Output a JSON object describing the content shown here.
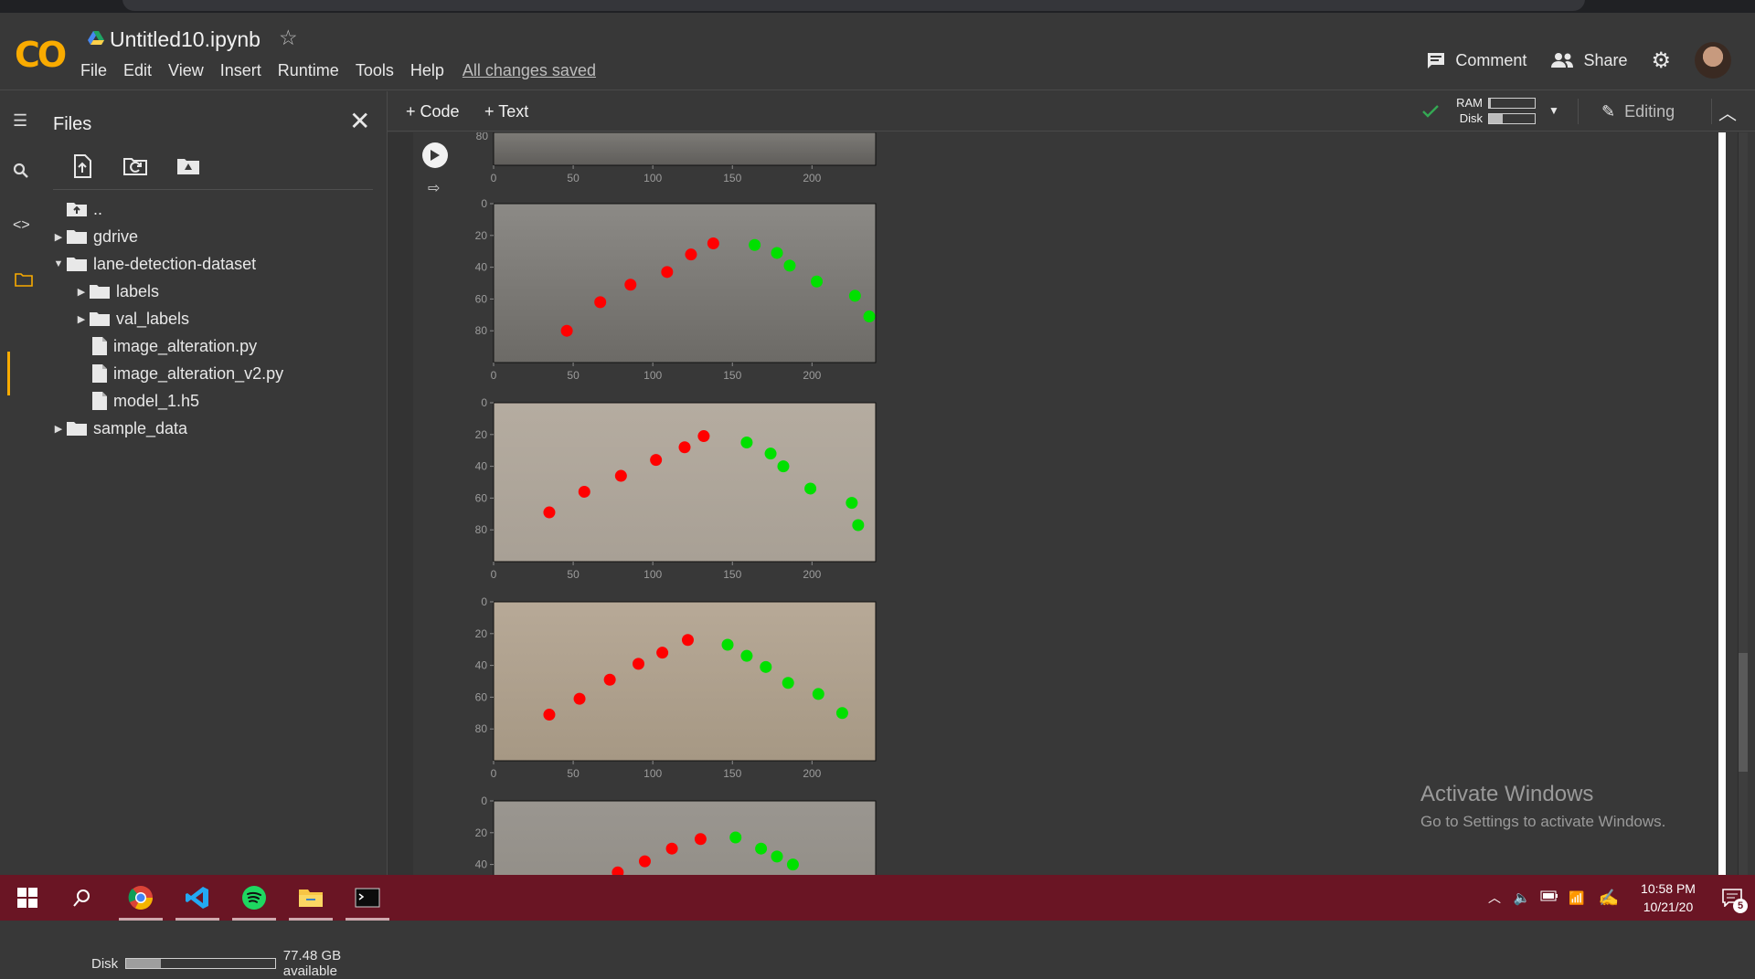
{
  "header": {
    "logo": "CO",
    "title": "Untitled10.ipynb",
    "star_icon": "star-outline-icon",
    "menu": [
      "File",
      "Edit",
      "View",
      "Insert",
      "Runtime",
      "Tools",
      "Help"
    ],
    "save_status": "All changes saved",
    "comment_label": "Comment",
    "share_label": "Share"
  },
  "rail": {
    "icons": [
      "toc-icon",
      "search-icon",
      "code-snippets-icon",
      "files-icon"
    ]
  },
  "files": {
    "title": "Files",
    "tree": [
      {
        "label": "..",
        "type": "up",
        "depth": 0
      },
      {
        "label": "gdrive",
        "type": "folder",
        "depth": 0,
        "expanded": false
      },
      {
        "label": "lane-detection-dataset",
        "type": "folder",
        "depth": 0,
        "expanded": true
      },
      {
        "label": "labels",
        "type": "folder",
        "depth": 1,
        "expanded": false
      },
      {
        "label": "val_labels",
        "type": "folder",
        "depth": 1,
        "expanded": false
      },
      {
        "label": "image_alteration.py",
        "type": "file",
        "depth": 1
      },
      {
        "label": "image_alteration_v2.py",
        "type": "file",
        "depth": 1
      },
      {
        "label": "model_1.h5",
        "type": "file",
        "depth": 1
      },
      {
        "label": "sample_data",
        "type": "folder",
        "depth": 0,
        "expanded": false
      }
    ],
    "disk_label": "Disk",
    "disk_available": "77.48 GB available",
    "disk_used_fraction": 0.23
  },
  "toolbar": {
    "add_code": "+ Code",
    "add_text": "+ Text",
    "ram_label": "RAM",
    "disk_label": "Disk",
    "ram_used_fraction": 0.04,
    "disk_used_fraction": 0.3,
    "editing_label": "Editing"
  },
  "plots": {
    "x_ticks": [
      "0",
      "50",
      "100",
      "150",
      "200"
    ],
    "y_ticks": [
      "0",
      "20",
      "40",
      "60",
      "80"
    ],
    "partial_top_y_tick": "80",
    "red_color": "#ff0000",
    "green_color": "#00e000",
    "images": [
      {
        "red": [
          [
            46,
            80
          ],
          [
            67,
            62
          ],
          [
            86,
            51
          ],
          [
            109,
            43
          ],
          [
            124,
            32
          ],
          [
            138,
            25
          ]
        ],
        "green": [
          [
            164,
            26
          ],
          [
            178,
            31
          ],
          [
            186,
            39
          ],
          [
            203,
            49
          ],
          [
            227,
            58
          ],
          [
            236,
            71
          ]
        ]
      },
      {
        "red": [
          [
            35,
            69
          ],
          [
            57,
            56
          ],
          [
            80,
            46
          ],
          [
            102,
            36
          ],
          [
            120,
            28
          ],
          [
            132,
            21
          ]
        ],
        "green": [
          [
            159,
            25
          ],
          [
            174,
            32
          ],
          [
            182,
            40
          ],
          [
            199,
            54
          ],
          [
            225,
            63
          ],
          [
            229,
            77
          ]
        ]
      },
      {
        "red": [
          [
            35,
            71
          ],
          [
            54,
            61
          ],
          [
            73,
            49
          ],
          [
            91,
            39
          ],
          [
            106,
            32
          ],
          [
            122,
            24
          ]
        ],
        "green": [
          [
            147,
            27
          ],
          [
            159,
            34
          ],
          [
            171,
            41
          ],
          [
            185,
            51
          ],
          [
            204,
            58
          ],
          [
            219,
            70
          ]
        ]
      },
      {
        "red": [
          [
            78,
            45
          ],
          [
            95,
            38
          ],
          [
            112,
            30
          ],
          [
            130,
            24
          ]
        ],
        "green": [
          [
            152,
            23
          ],
          [
            168,
            30
          ],
          [
            178,
            35
          ],
          [
            188,
            40
          ]
        ]
      }
    ]
  },
  "watermark": {
    "line1": "Activate Windows",
    "line2": "Go to Settings to activate Windows."
  },
  "taskbar": {
    "apps": [
      "windows-start-icon",
      "search-icon",
      "chrome-icon",
      "vscode-icon",
      "spotify-icon",
      "file-explorer-icon",
      "terminal-icon"
    ],
    "time": "10:58 PM",
    "date": "10/21/20",
    "notification_count": "5"
  }
}
